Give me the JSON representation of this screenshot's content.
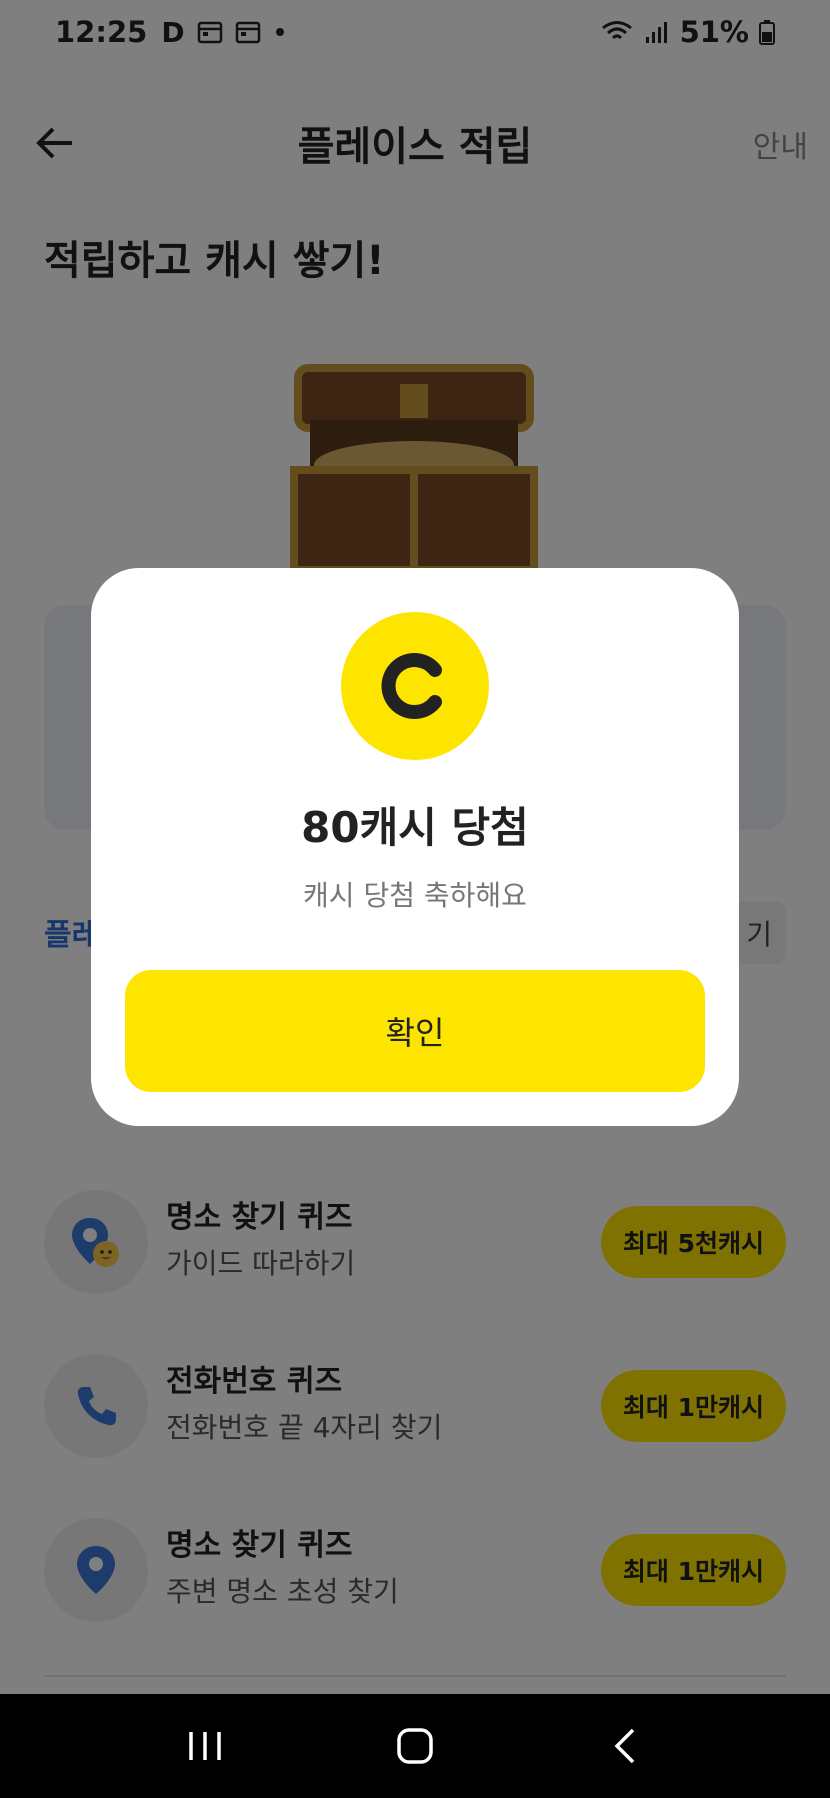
{
  "status_bar": {
    "time": "12:25",
    "battery": "51%",
    "icons": [
      "d-app-icon",
      "calendar-icon",
      "calendar-icon",
      "dot-icon",
      "wifi-icon",
      "signal-icon",
      "battery-icon"
    ]
  },
  "header": {
    "title": "플레이스 적립",
    "guide": "안내"
  },
  "hero": {
    "title": "적립하고 캐시 쌓기!"
  },
  "section": {
    "label": "플레",
    "button_fragment": "기"
  },
  "quizzes": [
    {
      "title": "명소 찾기 퀴즈",
      "subtitle": "가이드 따라하기",
      "reward": "최대 5천캐시",
      "icon": "map-pin-smile-icon"
    },
    {
      "title": "전화번호 퀴즈",
      "subtitle": "전화번호 끝 4자리 찾기",
      "reward": "최대 1만캐시",
      "icon": "phone-icon"
    },
    {
      "title": "명소 찾기 퀴즈",
      "subtitle": "주변 명소 초성 찾기",
      "reward": "최대 1만캐시",
      "icon": "map-pin-icon"
    }
  ],
  "modal": {
    "coin_letter": "C",
    "title": "80캐시 당첨",
    "subtitle": "캐시 당첨 축하해요",
    "confirm": "확인"
  },
  "colors": {
    "accent_yellow": "#fee500",
    "link_blue": "#2f6fd8",
    "overlay": "rgba(0,0,0,0.5)"
  }
}
